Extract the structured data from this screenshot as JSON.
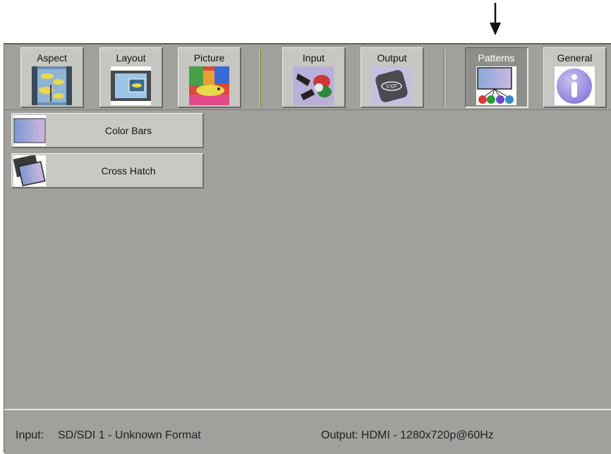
{
  "toolbar": {
    "tabs": [
      {
        "label": "Aspect",
        "icon": "aspect-fish-icon"
      },
      {
        "label": "Layout",
        "icon": "layout-window-icon"
      },
      {
        "label": "Picture",
        "icon": "picture-fish-icon"
      },
      {
        "label": "Input",
        "icon": "input-cable-icon"
      },
      {
        "label": "Output",
        "icon": "output-vxp-icon"
      },
      {
        "label": "Patterns",
        "icon": "patterns-icon",
        "active": true
      },
      {
        "label": "General",
        "icon": "info-icon"
      }
    ]
  },
  "patterns": {
    "items": [
      {
        "label": "Color Bars",
        "icon": "color-bars-thumb-icon"
      },
      {
        "label": "Cross Hatch",
        "icon": "cross-hatch-thumb-icon"
      }
    ]
  },
  "status": {
    "input_label": "Input:",
    "input_value": "SD/SDI 1 - Unknown Format",
    "output_text": "Output: HDMI - 1280x720p@60Hz"
  },
  "colors": {
    "background": "#a0a09c",
    "tab_face": "#c6c6c2",
    "tab_active": "#8e8e8a"
  }
}
